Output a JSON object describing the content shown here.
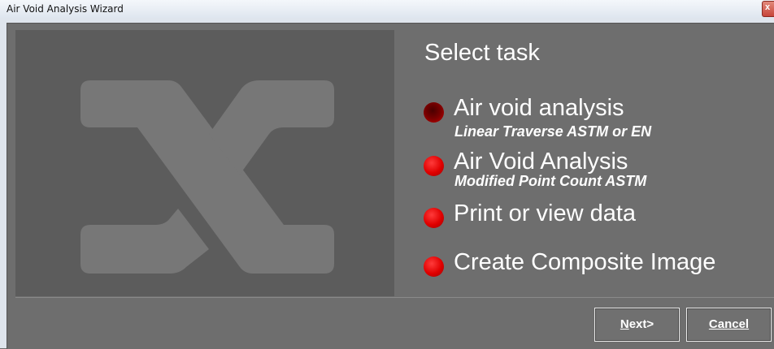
{
  "window": {
    "title": "Air Void Analysis Wizard",
    "close_glyph": "x"
  },
  "task_panel": {
    "heading": "Select task",
    "options": [
      {
        "label": "Air void analysis",
        "sublabel": "Linear Traverse ASTM or EN",
        "selected": true
      },
      {
        "label": "Air Void Analysis",
        "sublabel": "Modified Point Count ASTM",
        "selected": false
      },
      {
        "label": "Print or view data",
        "sublabel": "",
        "selected": false
      },
      {
        "label": "Create Composite Image",
        "sublabel": "",
        "selected": false
      }
    ]
  },
  "buttons": {
    "next_label": "Next>",
    "cancel_label": "Cancel"
  },
  "icons": {
    "logo": "x-logo-icon",
    "radio_selected": "radio-selected-icon",
    "radio": "radio-icon"
  },
  "colors": {
    "radio_red": "#e00000",
    "radio_selected": "#6a0000",
    "panel_dark": "#5c5c5c",
    "panel": "#6e6e6e"
  }
}
